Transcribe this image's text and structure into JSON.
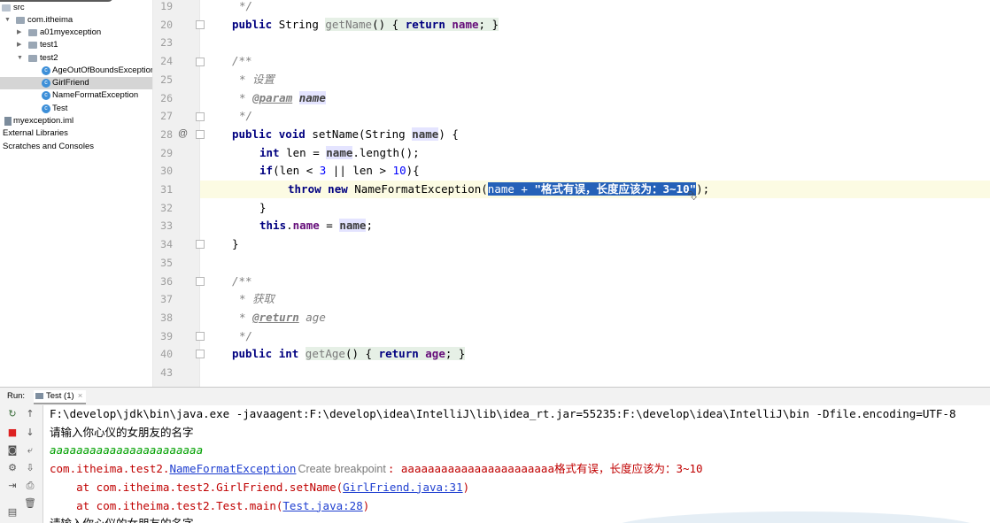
{
  "project_tree": {
    "rows": [
      {
        "label": "src",
        "type": "folder"
      },
      {
        "label": "com.itheima",
        "type": "package"
      },
      {
        "label": "a01myexception",
        "type": "package"
      },
      {
        "label": "test1",
        "type": "package"
      },
      {
        "label": "test2",
        "type": "package"
      },
      {
        "label": "AgeOutOfBoundsException",
        "type": "class"
      },
      {
        "label": "GirlFriend",
        "type": "class"
      },
      {
        "label": "NameFormatException",
        "type": "class"
      },
      {
        "label": "Test",
        "type": "class"
      },
      {
        "label": "myexception.iml",
        "type": "file"
      },
      {
        "label": "External Libraries",
        "type": "node"
      },
      {
        "label": "Scratches and Consoles",
        "type": "node"
      }
    ],
    "selected": "GirlFriend"
  },
  "editor": {
    "line_numbers": [
      "19",
      "20",
      "23",
      "24",
      "25",
      "26",
      "27",
      "28",
      "29",
      "30",
      "31",
      "32",
      "33",
      "34",
      "35",
      "36",
      "37",
      "38",
      "39",
      "40",
      "43"
    ],
    "current_line": "31",
    "override_marker": "@",
    "code": {
      "l19": "*/",
      "l20": {
        "kw": "public",
        "type": "String",
        "method": "getName",
        "body": "{",
        "ret": "return",
        "field": "name",
        "end": "; }"
      },
      "l24": "/**",
      "l25": "* 设置",
      "l26_tag": "@param",
      "l26_param": "name",
      "l27": "*/",
      "l28": {
        "kw1": "public",
        "kw2": "void",
        "method": "setName(String ",
        "param": "name",
        "end": ") {"
      },
      "l29": {
        "kw": "int",
        "text1": " len = ",
        "param": "name",
        "text2": ".length();"
      },
      "l30": {
        "kw": "if",
        "text1": "(len < ",
        "num1": "3",
        "text2": " || len > ",
        "num2": "10",
        "text3": "){"
      },
      "l31": {
        "kw1": "throw",
        "kw2": "new",
        "cls": " NameFormatException(",
        "sel_a": "name + ",
        "sel_str": "\"格式有误，长度应该为：3~10\"",
        "end": ");"
      },
      "l32": "}",
      "l33": {
        "kw": "this",
        "dot": ".",
        "field": "name",
        "eq": " = ",
        "param": "name",
        "end": ";"
      },
      "l34": "}",
      "l36": "/**",
      "l37": "* 获取",
      "l38_tag": "@return",
      "l38_text": " age",
      "l39": "*/",
      "l40": {
        "kw1": "public",
        "kw2": "int",
        "method": "getAge",
        "body": "() {",
        "ret": "return",
        "field": "age",
        "end": "; }"
      }
    }
  },
  "run_panel": {
    "label": "Run:",
    "tab": "Test (1)",
    "tab_close": "×",
    "console": {
      "cmd": "F:\\develop\\jdk\\bin\\java.exe -javaagent:F:\\develop\\idea\\IntelliJ\\lib\\idea_rt.jar=55235:F:\\develop\\idea\\IntelliJ\\bin -Dfile.encoding=UTF-8",
      "prompt1": "请输入你心仪的女朋友的名字",
      "input": "aaaaaaaaaaaaaaaaaaaaaaa",
      "exc_prefix": "com.itheima.test2.",
      "exc_link": "NameFormatException",
      "exc_hint": "Create breakpoint",
      "exc_msg": ": aaaaaaaaaaaaaaaaaaaaaaa格式有误，长度应该为：3~10",
      "at1_prefix": "    at com.itheima.test2.GirlFriend.setName(",
      "at1_link": "GirlFriend.java:31",
      "at1_end": ")",
      "at2_prefix": "    at com.itheima.test2.Test.main(",
      "at2_link": "Test.java:28",
      "at2_end": ")",
      "prompt2": "请输入你心仪的女朋友的名字"
    }
  }
}
